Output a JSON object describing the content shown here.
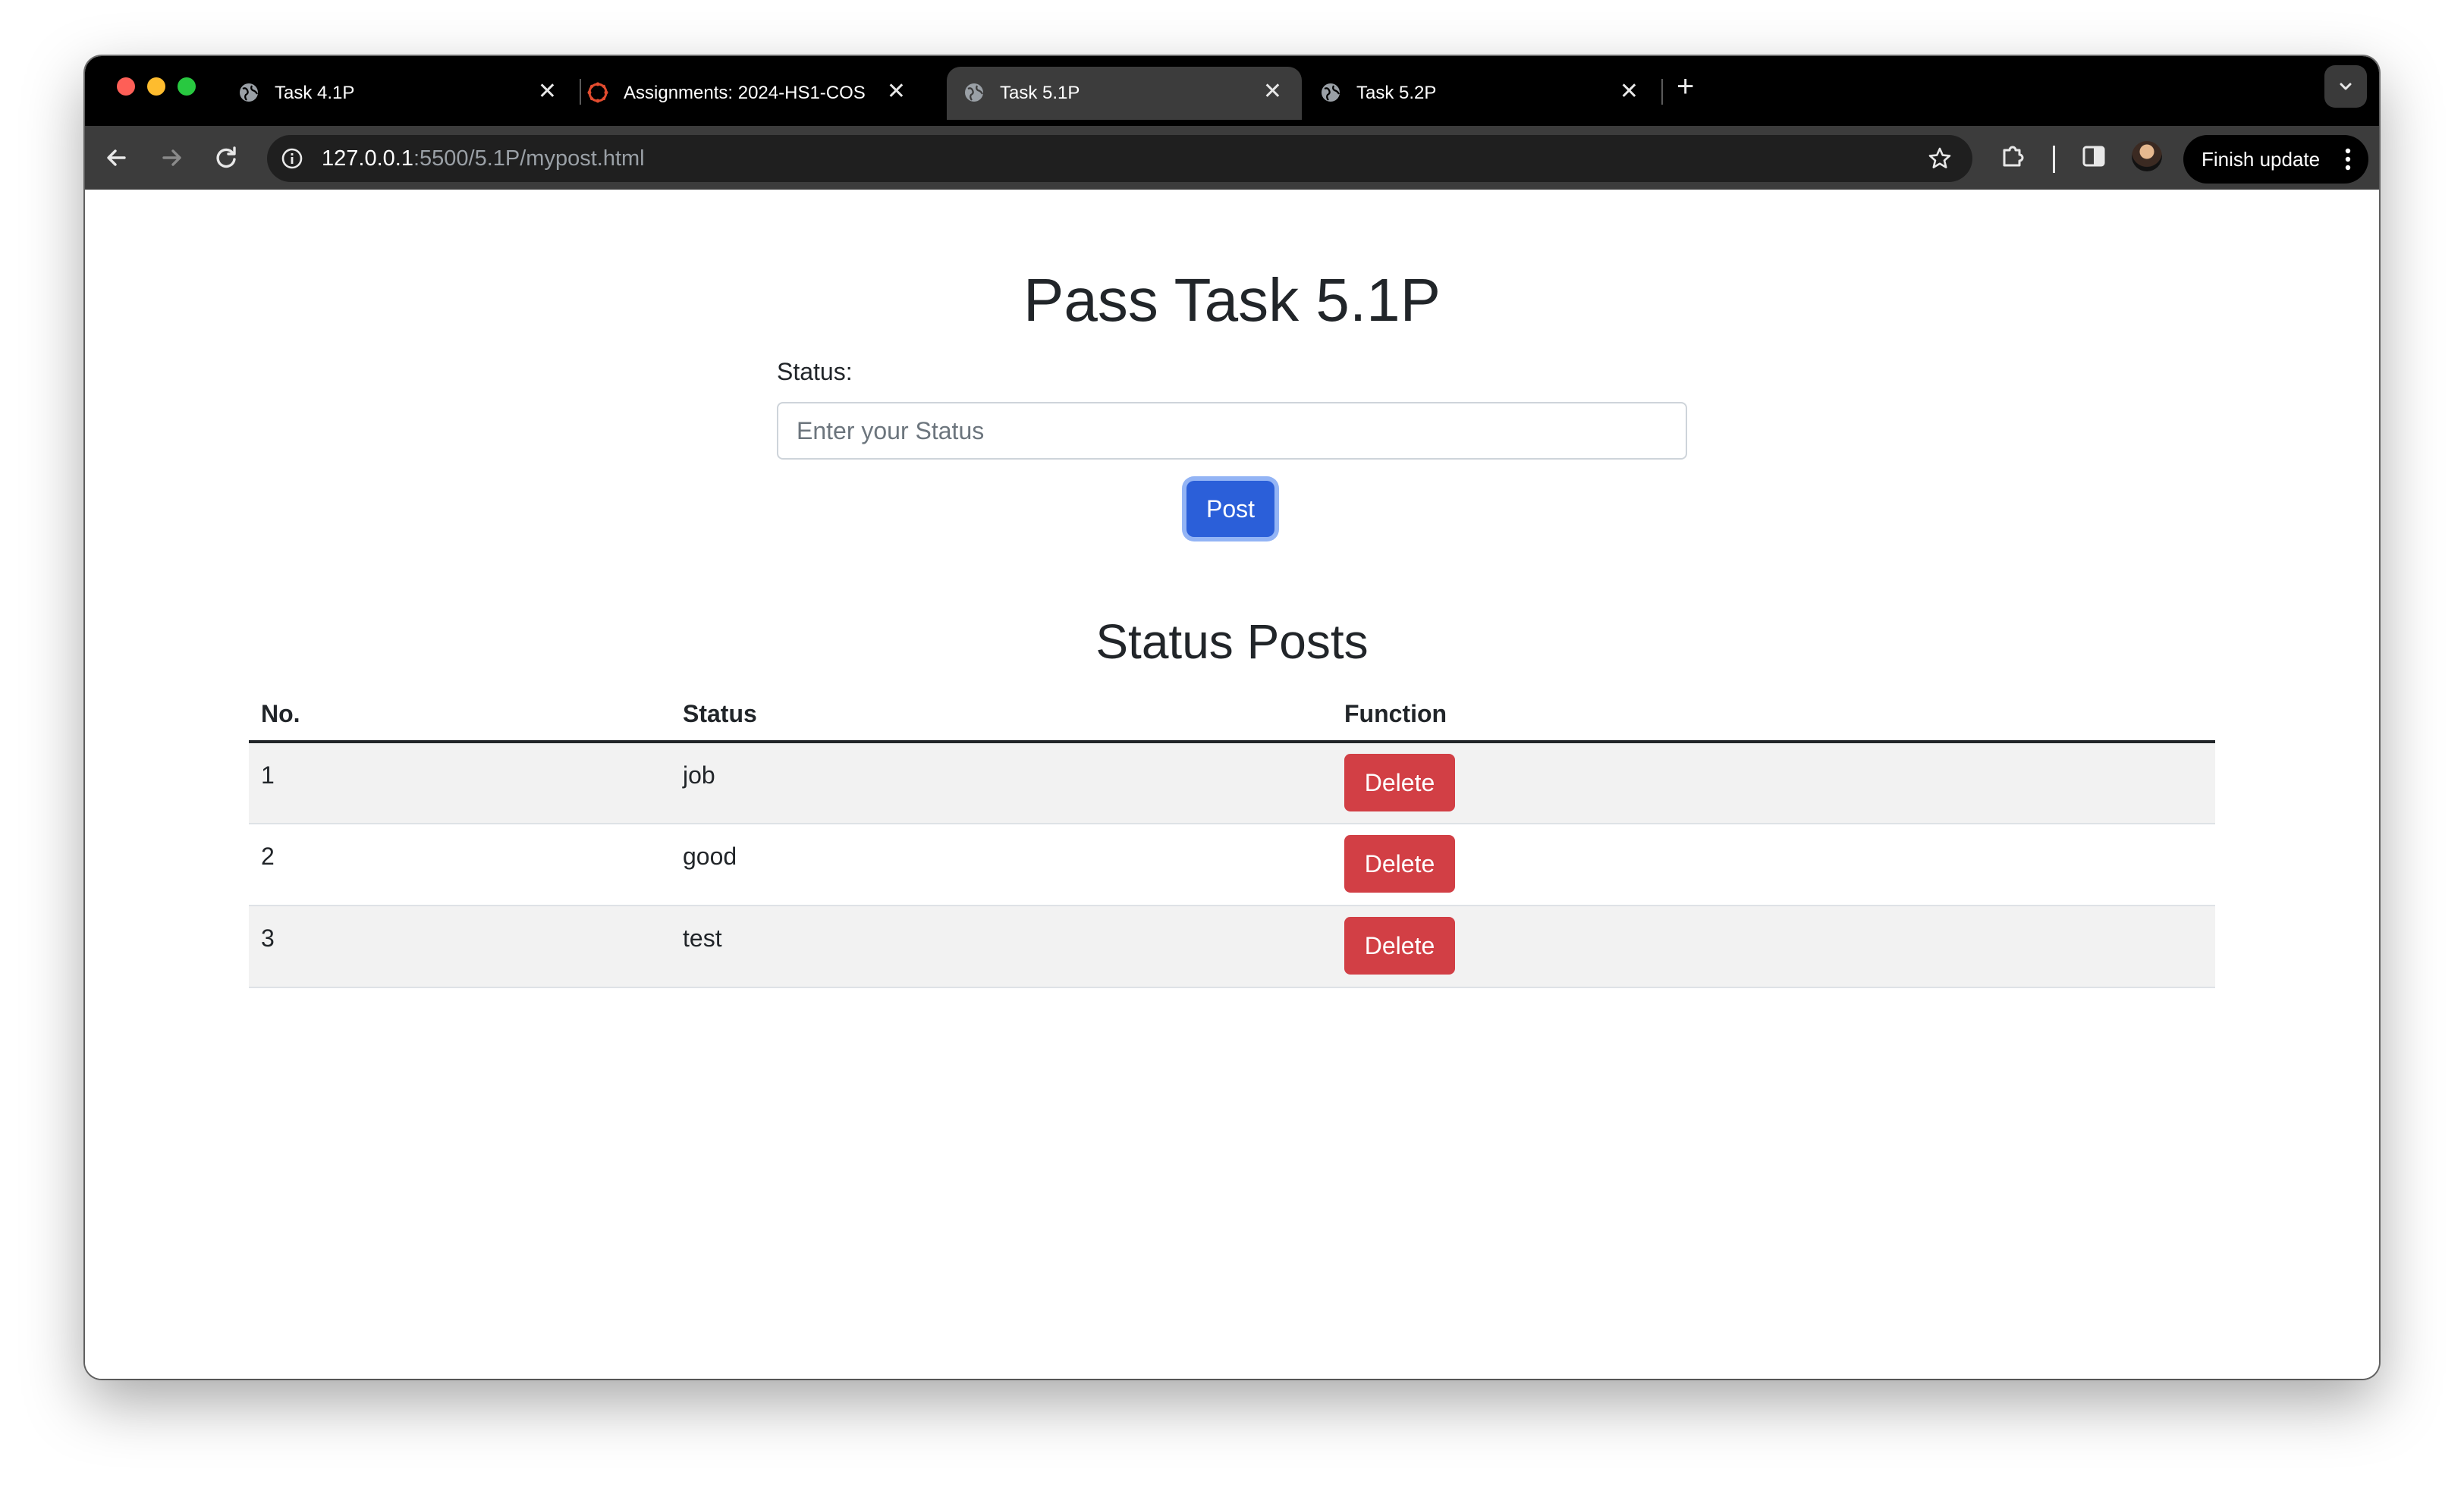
{
  "browser": {
    "tabs": [
      {
        "title": "Task 4.1P",
        "icon": "globe-icon",
        "active": false
      },
      {
        "title": "Assignments: 2024-HS1-COS",
        "icon": "canvas-logo-icon",
        "active": false
      },
      {
        "title": "Task 5.1P",
        "icon": "globe-icon",
        "active": true
      },
      {
        "title": "Task 5.2P",
        "icon": "globe-icon",
        "active": false
      }
    ],
    "close_glyph": "✕",
    "new_tab_glyph": "+",
    "url_host": "127.0.0.1",
    "url_path": ":5500/5.1P/mypost.html",
    "finish_update_label": "Finish update"
  },
  "page": {
    "title": "Pass Task 5.1P",
    "status_label": "Status:",
    "status_value": "",
    "status_placeholder": "Enter your Status",
    "post_button": "Post",
    "posts_title": "Status Posts",
    "columns": [
      "No.",
      "Status",
      "Function"
    ],
    "rows": [
      {
        "no": "1",
        "status": "job",
        "action": "Delete"
      },
      {
        "no": "2",
        "status": "good",
        "action": "Delete"
      },
      {
        "no": "3",
        "status": "test",
        "action": "Delete"
      }
    ]
  },
  "colors": {
    "primary_button": "#2b5fd9",
    "danger_button": "#d23f45",
    "tab_strip": "#000000",
    "toolbar": "#3c3c3c"
  }
}
